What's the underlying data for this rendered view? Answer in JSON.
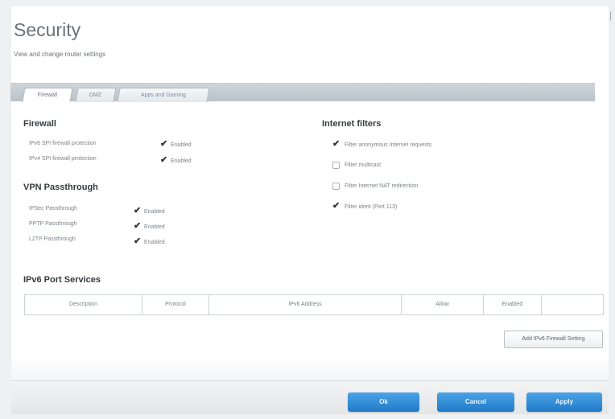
{
  "page": {
    "title": "Security",
    "subtitle": "View and change router settings"
  },
  "tabs": [
    {
      "label": "Firewall",
      "active": true
    },
    {
      "label": "DMZ",
      "active": false
    },
    {
      "label": "Apps and Gaming",
      "active": false
    }
  ],
  "firewall": {
    "heading": "Firewall",
    "rows": [
      {
        "label": "IPv6 SPI firewall protection",
        "checkbox_label": "Enabled",
        "checked": true
      },
      {
        "label": "IPv4 SPI firewall protection",
        "checkbox_label": "Enabled",
        "checked": true
      }
    ]
  },
  "vpn": {
    "heading": "VPN Passthrough",
    "rows": [
      {
        "label": "IPSec Passthrough",
        "checkbox_label": "Enabled",
        "checked": true
      },
      {
        "label": "PPTP Passthrough",
        "checkbox_label": "Enabled",
        "checked": true
      },
      {
        "label": "L2TP Passthrough",
        "checkbox_label": "Enabled",
        "checked": true
      }
    ]
  },
  "internet_filters": {
    "heading": "Internet filters",
    "items": [
      {
        "label": "Filter anonymous Internet requests",
        "checked": true
      },
      {
        "label": "Filter multicast",
        "checked": false
      },
      {
        "label": "Filter Internet NAT redirection",
        "checked": false
      },
      {
        "label": "Filter ident (Port 113)",
        "checked": true
      }
    ]
  },
  "ipv6_services": {
    "heading": "IPv6 Port Services",
    "columns": [
      "Description",
      "Protocol",
      "IPv6 Address",
      "Allow",
      "Enabled",
      ""
    ]
  },
  "add_rule_label": "Add IPv6 Firewall Setting",
  "actions": {
    "ok": "Ok",
    "cancel": "Cancel",
    "apply": "Apply"
  },
  "colors": {
    "accent": "#2a86d3",
    "heading": "#353b3e"
  }
}
